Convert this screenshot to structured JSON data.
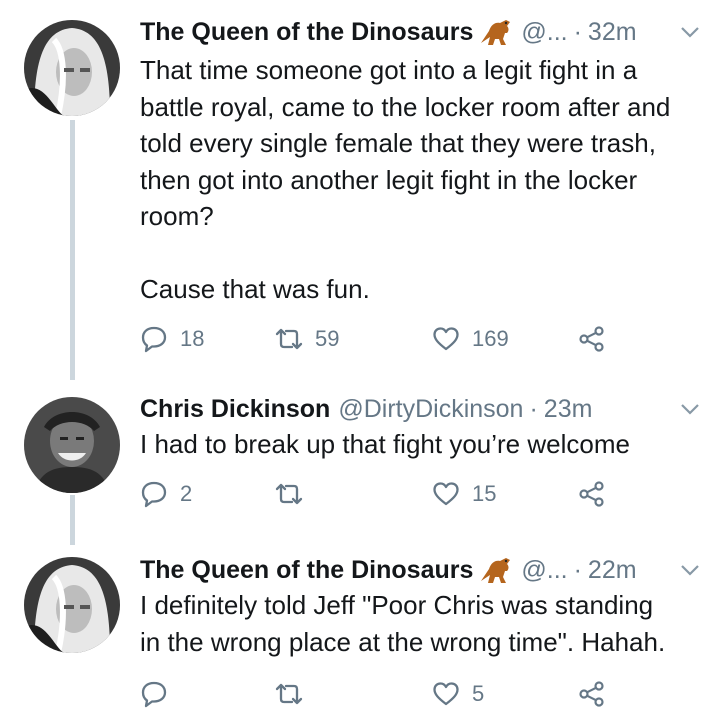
{
  "tweets": [
    {
      "display_name": "The Queen of the Dinosaurs",
      "emoji": "dinosaur-emoji",
      "handle": "@...",
      "separator": "·",
      "time": "32m",
      "text": "That time someone got into a legit fight in a\nbattle royal, came to the locker room after and\ntold every single female that they were trash,\nthen got into another legit fight in the locker\nroom?\n\nCause that was fun.",
      "reply_count": "18",
      "retweet_count": "59",
      "like_count": "169"
    },
    {
      "display_name": "Chris Dickinson",
      "handle": "@DirtyDickinson",
      "separator": "·",
      "time": "23m",
      "text": "I had to break up that fight you’re welcome",
      "reply_count": "2",
      "retweet_count": "",
      "like_count": "15"
    },
    {
      "display_name": "The Queen of the Dinosaurs",
      "emoji": "dinosaur-emoji",
      "handle": "@...",
      "separator": "·",
      "time": "22m",
      "text": "I definitely told Jeff \"Poor Chris was standing\nin the wrong place at the wrong time\". Hahah.",
      "reply_count": "",
      "retweet_count": "",
      "like_count": "5"
    }
  ],
  "colors": {
    "text": "#14171a",
    "muted": "#657786",
    "thread_line": "#ccd6dd",
    "emoji": "#b5651d"
  }
}
